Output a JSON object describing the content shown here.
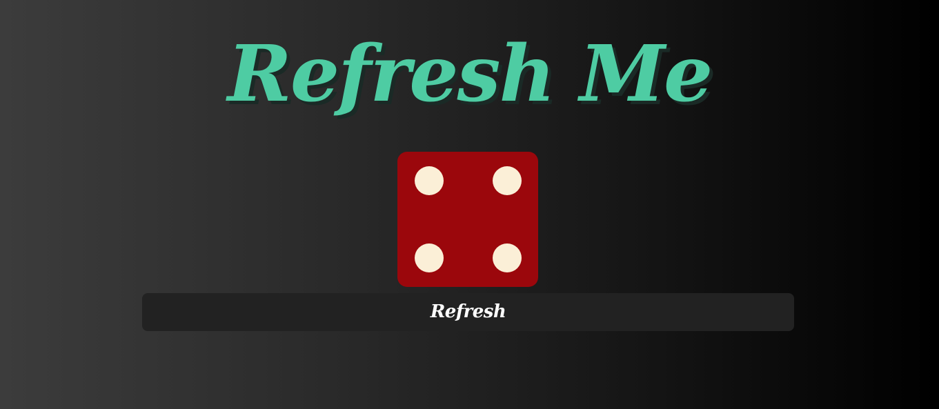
{
  "page": {
    "title": "Refresh Me"
  },
  "die": {
    "value": 4,
    "color": "#9b070c",
    "pip_color": "#fbefd7"
  },
  "controls": {
    "refresh_label": "Refresh"
  },
  "colors": {
    "title": "#4ecca3",
    "button_background": "#222222",
    "button_text": "#ffffff"
  }
}
